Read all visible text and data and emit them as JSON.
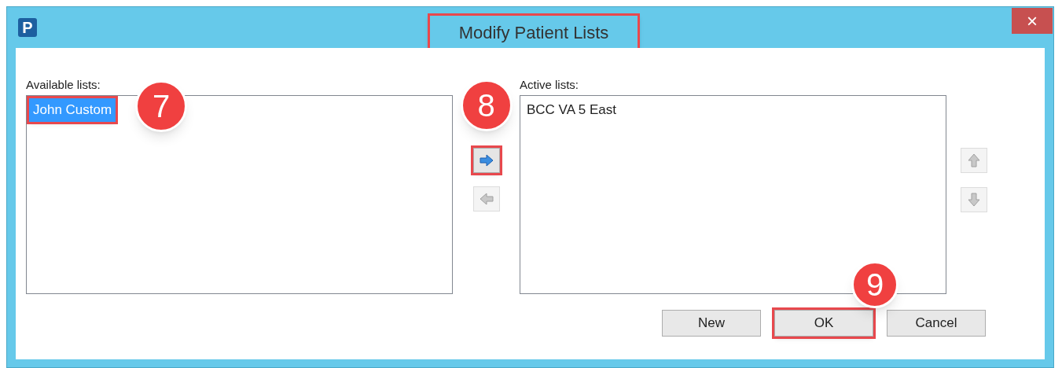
{
  "window": {
    "app_icon": "P",
    "title": "Modify Patient Lists",
    "title_highlighted": true,
    "close": "×"
  },
  "available": {
    "label": "Available lists:",
    "items": [
      {
        "text": "John Custom",
        "selected": true,
        "highlighted": true
      }
    ]
  },
  "move_buttons": [
    {
      "kind": "right",
      "disabled": false,
      "highlighted": true
    },
    {
      "kind": "left",
      "disabled": true,
      "highlighted": false
    }
  ],
  "active": {
    "label": "Active lists:",
    "items": [
      {
        "text": "BCC VA 5 East",
        "selected": false,
        "highlighted": false
      }
    ]
  },
  "order_buttons": [
    {
      "kind": "up",
      "disabled": true
    },
    {
      "kind": "down",
      "disabled": true
    }
  ],
  "buttons": [
    {
      "label": "New",
      "highlighted": false
    },
    {
      "label": "OK",
      "highlighted": true
    },
    {
      "label": "Cancel",
      "highlighted": false
    }
  ],
  "callouts": [
    "7",
    "8",
    "9"
  ]
}
